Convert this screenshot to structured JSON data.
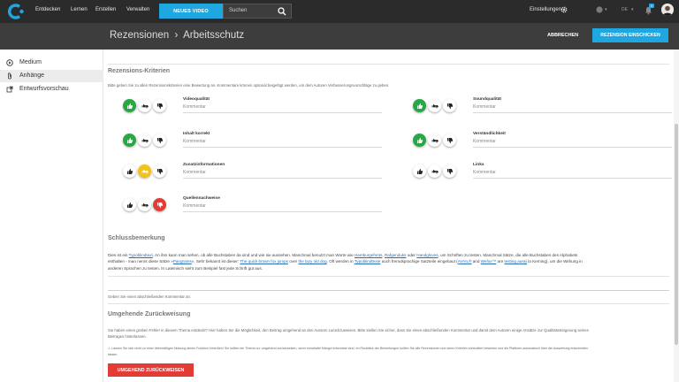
{
  "nav": {
    "links": [
      "Entdecken",
      "Lernen",
      "Erstellen",
      "Verwalten"
    ],
    "new_video": "NEUES VIDEO",
    "search_placeholder": "Suchen",
    "settings": "Einstellungen",
    "language": "DE",
    "notifications": "9"
  },
  "header": {
    "breadcrumb": "Rezensionen  ›  Arbeitsschutz",
    "cancel": "ABBRECHEN",
    "submit": "REZENSION EINSCHICKEN"
  },
  "sidebar": {
    "items": [
      {
        "label": "Medium",
        "icon": "play-circle-icon"
      },
      {
        "label": "Anhänge",
        "icon": "paperclip-icon"
      },
      {
        "label": "Entwurfsvorschau",
        "icon": "external-link-icon"
      }
    ]
  },
  "review": {
    "title": "Rezensions-Kriterien",
    "intro": "Bitte geben Sie zu allen Rezensionskriterien eine Bewertung an. Kommentare können optional beigefügt werden, um dem Autoren Verbesserungsvorschläge zu geben.",
    "comment_label": "Kommentar",
    "criteria": [
      {
        "name": "Videoqualität",
        "rating": "up"
      },
      {
        "name": "Soundqualität",
        "rating": "up"
      },
      {
        "name": "Inhalt korrekt",
        "rating": "up"
      },
      {
        "name": "Verständlichkeit",
        "rating": "up"
      },
      {
        "name": "Zusatzinformationen",
        "rating": "mid"
      },
      {
        "name": "Links",
        "rating": "none"
      },
      {
        "name": "Quellennachweise",
        "rating": "down"
      }
    ],
    "colors": {
      "up": "#27a844",
      "mid": "#f2c21b",
      "down": "#e33b36"
    }
  },
  "final": {
    "title": "Schlussbemerkung",
    "line1_a": "Dies ist ein",
    "link1": "Typoblindtext",
    "line1_b": ". An ihm kann man sehen, ob alle Buchstaben da sind und wie sie aussehen. Manchmal benutzt man Worte wie",
    "link2": "Hamburgefonts",
    "sep1": ",",
    "link3": "Rafgenduks",
    "sep2": "oder",
    "link4": "Handgloves",
    "line1_c": ", um Schriften zu testen. Manchmal Sätze, die alle Buchstaben des Alphabets",
    "line2_a": "enthalten - man nennt diese Sätze »",
    "link5": "Pangrams",
    "line2_b": "«. Sehr bekannt ist dieser:",
    "link6": "The quick brown fox jumps",
    "line2_c": "over",
    "link7": "the lazy old dog",
    "line2_d": ". Oft werden in",
    "link8": "Typoblindtexte",
    "line2_e": "auch fremdsprachige Satzteile eingebaut (",
    "link9": "AVAIL®",
    "line2_f": "and",
    "link10": "Wefox™",
    "line2_g": "are",
    "link11": "testing aussi",
    "line2_h": "la Kerning), um die Wirkung in",
    "line3": "anderen Sprachen zu testen. In Lateinisch sieht zum Beispiel fast jede Schrift gut aus.",
    "hint": "Geben Sie einen abschließenden Kommentar an."
  },
  "reject": {
    "title": "Umgehende Zurückweisung",
    "text1": "Sie haben einen groben Fehler in diesem Thema entdeckt? Hier haben Sie die Möglichkeit, den Beitrag umgehend an den Autoren zurückzuweisen. Bitte stellen Sie sicher, dass Sie einen abschließenden Kommentar und damit dem Autoren einige Ansätze zur Qualitätssteigerung seines",
    "text1b": "Beitrages hinterlassen.",
    "warn1": "Lassen Sie sich nicht zu einer übermäßigen Nutzung dieser Funktion hinreißen! Sie sollten ein Thema nur umgehend zurückweisen, wenn ernsthafte Mängel erkennbar sind. Im Rückblick der Bewertungen sollten Sie alle Rezensionen und deren Kriterien kontrolliert bewerten und die Plattform automatisch über die Auswertung entscheiden",
    "warn2": "lassen.",
    "button": "UMGEHEND ZURÜCKWEISEN"
  }
}
